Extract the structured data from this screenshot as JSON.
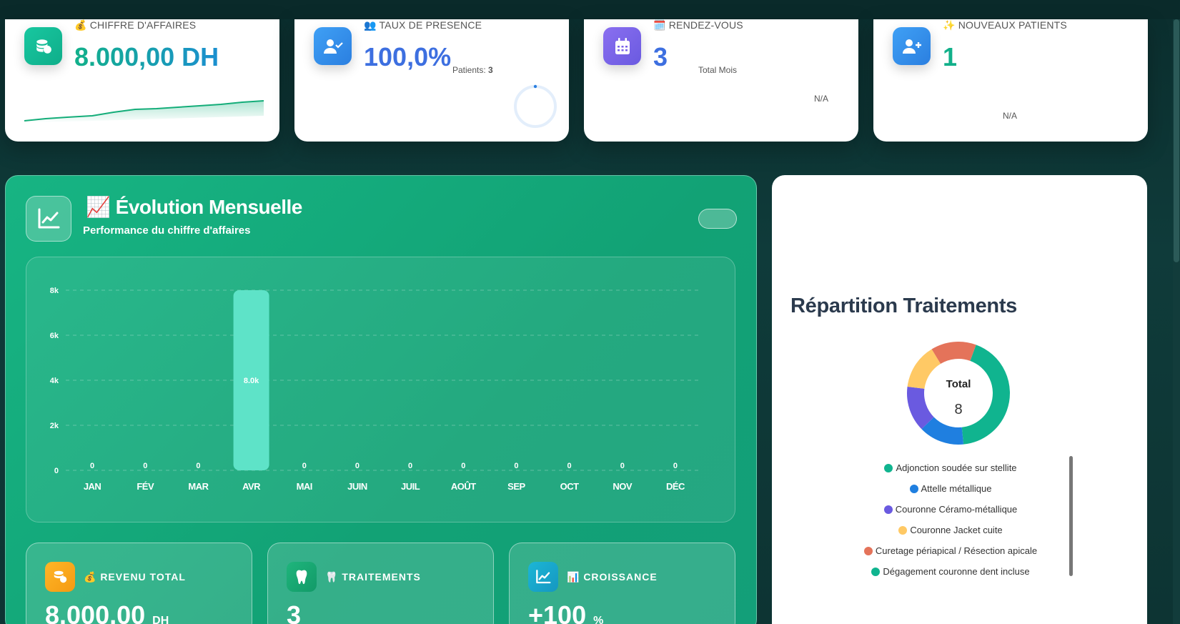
{
  "kpis": [
    {
      "label": "💰 CHIFFRE D'AFFAIRES",
      "value": "8.000,00 DH",
      "icon": "coins-icon"
    },
    {
      "label": "👥 TAUX DE PRESENCE",
      "value": "100,0%",
      "patients_label": "Patients:",
      "patients_value": "3",
      "icon": "user-check-icon"
    },
    {
      "label": "🗓️ RENDEZ-VOUS",
      "value": "3",
      "note": "Total Mois",
      "extra": "N/A",
      "icon": "calendar-icon"
    },
    {
      "label": "✨ NOUVEAUX PATIENTS",
      "value": "1",
      "extra": "N/A",
      "icon": "user-plus-icon"
    }
  ],
  "evolution": {
    "title": "📈 Évolution Mensuelle",
    "subtitle": "Performance du chiffre d'affaires"
  },
  "chart_data": {
    "type": "bar",
    "categories": [
      "JAN",
      "FÉV",
      "MAR",
      "AVR",
      "MAI",
      "JUIN",
      "JUIL",
      "AOÛT",
      "SEP",
      "OCT",
      "NOV",
      "DÉC"
    ],
    "values": [
      0,
      0,
      0,
      8000,
      0,
      0,
      0,
      0,
      0,
      0,
      0,
      0
    ],
    "value_labels": [
      "0",
      "0",
      "0",
      "8.0k",
      "0",
      "0",
      "0",
      "0",
      "0",
      "0",
      "0",
      "0"
    ],
    "yticks": [
      "0",
      "2k",
      "4k",
      "6k",
      "8k"
    ],
    "ylim": [
      0,
      8000
    ],
    "grid": true
  },
  "stats": [
    {
      "label": "💰 REVENU TOTAL",
      "value": "8.000,00",
      "unit": "DH",
      "icon": "coins-icon",
      "color": "#f7a21b"
    },
    {
      "label": "🦷 TRAITEMENTS",
      "value": "3",
      "unit": "",
      "icon": "tooth-icon",
      "color": "#17a36f"
    },
    {
      "label": "📊 CROISSANCE",
      "value": "+100",
      "unit": "%",
      "icon": "chart-line-icon",
      "color": "#15a6c9"
    }
  ],
  "repartition": {
    "title": "Répartition Traitements",
    "total_label": "Total",
    "total_value": "8",
    "slices": [
      {
        "name": "Adjonction soudée sur stellite",
        "value": 3,
        "color": "#10b48f"
      },
      {
        "name": "Attelle métallique",
        "value": 1,
        "color": "#1f7fe0"
      },
      {
        "name": "Couronne Céramo-métallique",
        "value": 1,
        "color": "#6a5ae0"
      },
      {
        "name": "Couronne Jacket cuite",
        "value": 1,
        "color": "#ffc965"
      },
      {
        "name": "Curetage périapical / Résection apicale",
        "value": 1,
        "color": "#e4735a"
      },
      {
        "name": "Dégagement couronne dent incluse",
        "value": 1,
        "color": "#10b48f"
      }
    ]
  }
}
